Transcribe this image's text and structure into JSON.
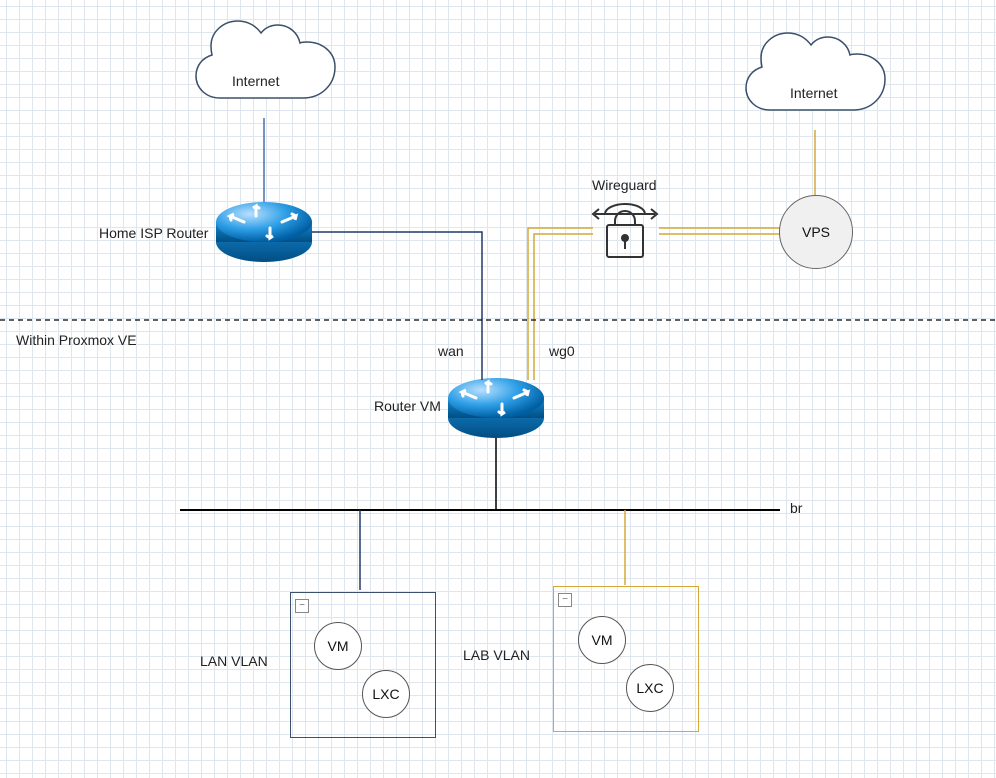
{
  "clouds": {
    "internet_left": "Internet",
    "internet_right": "Internet"
  },
  "nodes": {
    "home_isp_router": "Home ISP Router",
    "vps": "VPS",
    "wireguard": "Wireguard",
    "router_vm": "Router VM"
  },
  "interfaces": {
    "wan": "wan",
    "wg0": "wg0",
    "br": "br"
  },
  "section": {
    "within_proxmox": "Within Proxmox VE"
  },
  "vlans": {
    "lan": {
      "label": "LAN VLAN",
      "vm": "VM",
      "lxc": "LXC"
    },
    "lab": {
      "label": "LAB VLAN",
      "vm": "VM",
      "lxc": "LXC"
    }
  }
}
